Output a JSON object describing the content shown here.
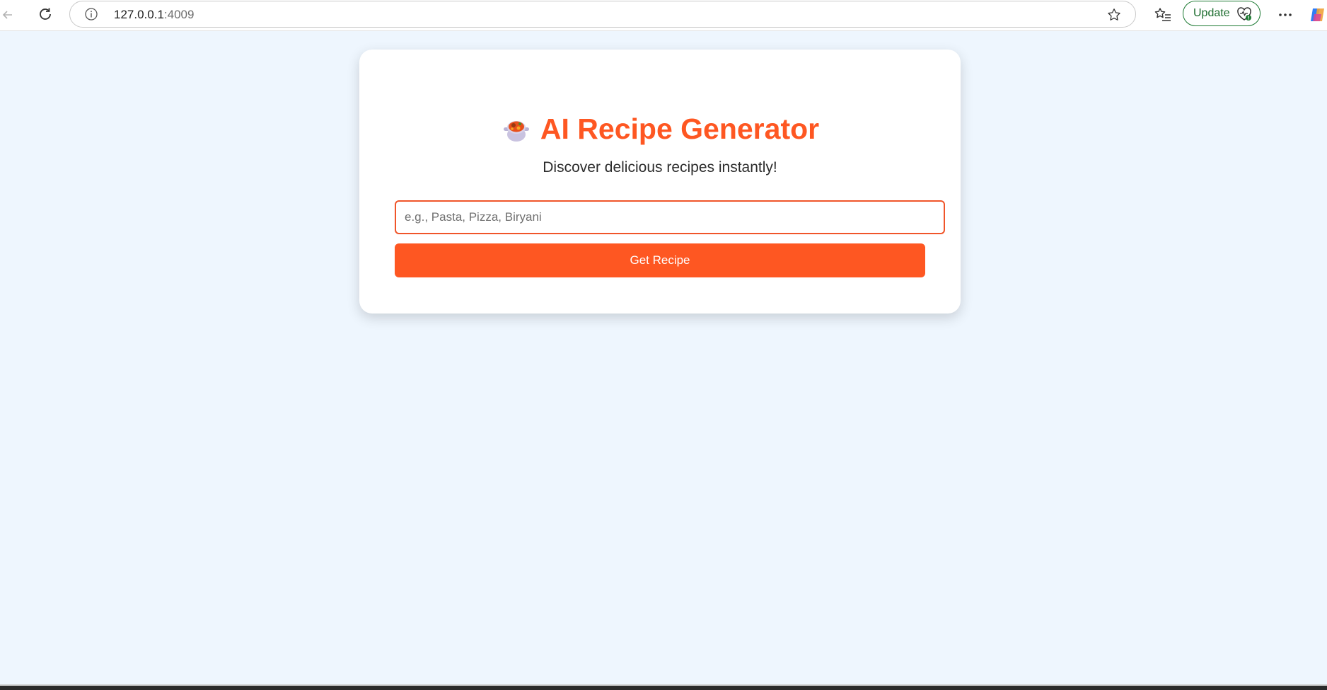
{
  "browser": {
    "url_host": "127.0.0.1",
    "url_port": ":4009",
    "update_label": "Update",
    "icons": [
      "back-arrow-icon",
      "reload-icon",
      "info-icon",
      "star-icon",
      "favorites-icon",
      "heart-health-icon",
      "more-icon",
      "copilot-icon"
    ]
  },
  "app": {
    "title": "AI Recipe Generator",
    "subtitle": "Discover delicious recipes instantly!",
    "search": {
      "placeholder": "e.g., Pasta, Pizza, Biryani",
      "value": ""
    },
    "submit_label": "Get Recipe",
    "accent_color": "#fe5722",
    "background_color": "#eef6fe"
  }
}
